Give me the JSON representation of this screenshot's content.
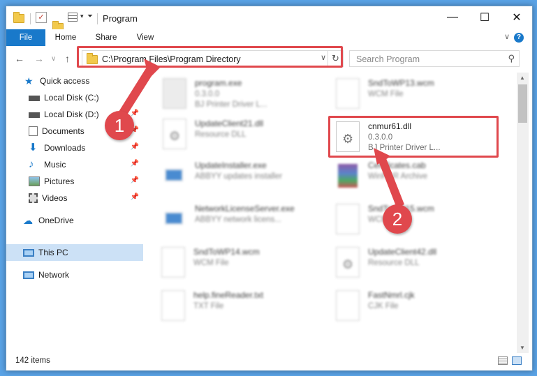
{
  "window": {
    "title": "Program",
    "minimize_glyph": "—",
    "maximize_glyph": "☐",
    "close_glyph": "✕"
  },
  "ribbon": {
    "tabs": [
      "File",
      "Home",
      "Share",
      "View"
    ],
    "help_glyph": "?"
  },
  "address": {
    "path": "C:\\Program Files\\Program Directory"
  },
  "search": {
    "placeholder": "Search Program"
  },
  "sidebar": {
    "items": [
      {
        "label": "Quick access",
        "icon": "star-icon"
      },
      {
        "label": "Local Disk (C:)",
        "icon": "drive-icon",
        "pinned": true
      },
      {
        "label": "Local Disk (D:)",
        "icon": "drive-icon",
        "pinned": true
      },
      {
        "label": "Documents",
        "icon": "documents-icon",
        "pinned": true
      },
      {
        "label": "Downloads",
        "icon": "downloads-icon",
        "pinned": true
      },
      {
        "label": "Music",
        "icon": "music-icon",
        "pinned": true
      },
      {
        "label": "Pictures",
        "icon": "pictures-icon",
        "pinned": true
      },
      {
        "label": "Videos",
        "icon": "videos-icon",
        "pinned": true
      },
      {
        "label": "OneDrive",
        "icon": "onedrive-icon"
      },
      {
        "label": "This PC",
        "icon": "this-pc-icon",
        "selected": true
      },
      {
        "label": "Network",
        "icon": "network-icon"
      }
    ]
  },
  "files": [
    {
      "name": "program.exe",
      "meta1": "0.3.0.0",
      "meta2": "BJ Printer Driver L..."
    },
    {
      "name": "SndToWP13.wcm",
      "meta1": "WCM File",
      "meta2": ""
    },
    {
      "name": "UpdateClient21.dll",
      "meta1": "Resource DLL",
      "meta2": ""
    },
    {
      "name": "cnmur61.dll",
      "meta1": "0.3.0.0",
      "meta2": "BJ Printer Driver L..."
    },
    {
      "name": "UpdateInstaller.exe",
      "meta1": "ABBYY updates installer",
      "meta2": ""
    },
    {
      "name": "Certificates.cab",
      "meta1": "WinRAR Archive",
      "meta2": ""
    },
    {
      "name": "NetworkLicenseServer.exe",
      "meta1": "ABBYY network licens...",
      "meta2": ""
    },
    {
      "name": "SndToWP15.wcm",
      "meta1": "WCM File",
      "meta2": ""
    },
    {
      "name": "SndToWP14.wcm",
      "meta1": "WCM File",
      "meta2": ""
    },
    {
      "name": "UpdateClient42.dll",
      "meta1": "Resource DLL",
      "meta2": ""
    },
    {
      "name": "help.fineReader.txt",
      "meta1": "TXT File",
      "meta2": ""
    },
    {
      "name": "FastNmrl.cjk",
      "meta1": "CJK File",
      "meta2": ""
    }
  ],
  "status": {
    "item_count": "142 items"
  },
  "callouts": [
    "1",
    "2"
  ],
  "colors": {
    "accent": "#1979ca",
    "highlight": "#e0484d",
    "selected": "#cce1f6"
  }
}
